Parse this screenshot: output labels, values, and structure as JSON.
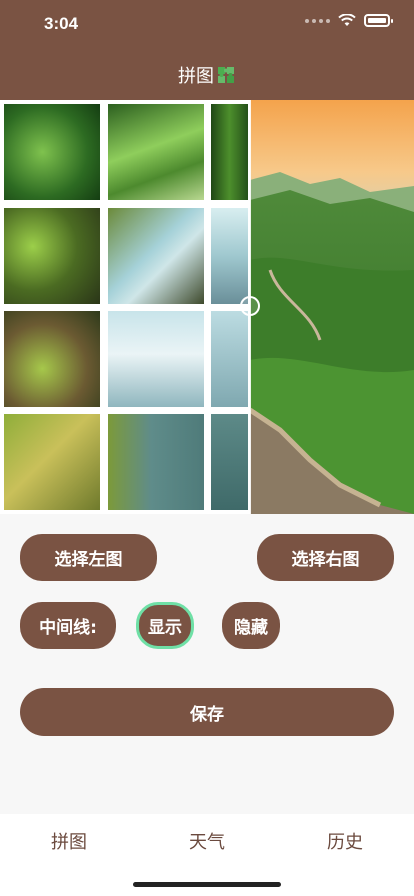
{
  "status": {
    "time": "3:04"
  },
  "nav": {
    "title": "拼图"
  },
  "buttons": {
    "select_left": "选择左图",
    "select_right": "选择右图",
    "midline_label": "中间线:",
    "show": "显示",
    "hide": "隐藏",
    "save": "保存"
  },
  "tabs": [
    "拼图",
    "天气",
    "历史"
  ],
  "colors": {
    "brand": "#7a5343",
    "active_outline": "#6fe0a6"
  }
}
